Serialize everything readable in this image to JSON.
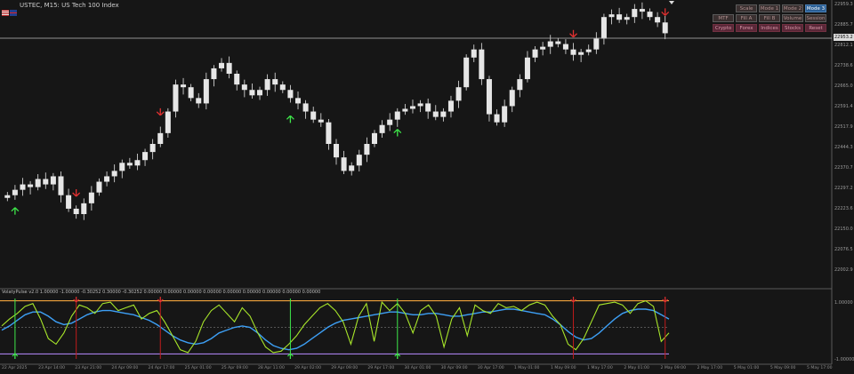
{
  "window": {
    "title": "USTEC, M15: US Tech 100 Index",
    "indicator_label": "VolatyPulse v2.0 1.00000 -1.00000 -0.30252 0.30000 -0.30252 0.00000 0.00000 0.00000 0.00000 0.00000 0.00000 0.00000 0.00000 0.00000"
  },
  "icons": {
    "flag": "us-gb-flag-icon",
    "collapse": "triangle-down-icon"
  },
  "colors": {
    "background": "#161616",
    "candle": "#e6e6e6",
    "osc_fast": "#a8e62a",
    "osc_slow": "#3d9ff5",
    "upper_band": "#f0a33c",
    "lower_band": "#a67ee8",
    "signal_line": "#c01b1b",
    "up_arrow": "#3ee84a",
    "down_arrow": "#e03030",
    "price_line": "#bdbdbd",
    "mode3_button": "#2b5f95",
    "pink_button": "#5a2738"
  },
  "buttons": {
    "row1": [
      "Scale",
      "Mode 1",
      "Mode 2",
      "Mode 3"
    ],
    "row2": [
      "MTF",
      "Fill A",
      "Fill B",
      "Volume",
      "Session"
    ],
    "row3": [
      "Crypto",
      "Forex",
      "Indices",
      "Stocks",
      "Reset"
    ]
  },
  "price_axis": {
    "labels": [
      "22959.3",
      "22885.7",
      "22812.1",
      "22738.6",
      "22665.0",
      "22591.4",
      "22517.9",
      "22444.3",
      "22370.7",
      "22297.2",
      "22223.6",
      "22150.0",
      "22076.5",
      "22002.9"
    ],
    "current": "22953.2",
    "osc_top": "1.00000",
    "osc_bottom": "-1.00000"
  },
  "time_axis": {
    "labels": [
      "22 Apr 2025",
      "23 Apr 14:00",
      "23 Apr 21:00",
      "24 Apr 09:00",
      "24 Apr 17:00",
      "25 Apr 01:00",
      "25 Apr 09:00",
      "28 Apr 11:00",
      "29 Apr 02:00",
      "29 Apr 09:00",
      "29 Apr 17:00",
      "30 Apr 01:00",
      "30 Apr 09:00",
      "30 Apr 17:00",
      "1 May 01:00",
      "1 May 09:00",
      "1 May 17:00",
      "2 May 01:00",
      "2 May 09:00",
      "2 May 17:00",
      "5 May 01:00",
      "5 May 09:00",
      "5 May 17:00"
    ]
  },
  "chart_data": {
    "type": "candlestick",
    "price_ylim": [
      21960,
      23000
    ],
    "close": [
      22290,
      22310,
      22330,
      22320,
      22350,
      22330,
      22360,
      22290,
      22240,
      22220,
      22260,
      22300,
      22340,
      22360,
      22380,
      22410,
      22400,
      22420,
      22450,
      22480,
      22520,
      22600,
      22700,
      22690,
      22650,
      22630,
      22720,
      22760,
      22780,
      22740,
      22700,
      22680,
      22660,
      22680,
      22720,
      22700,
      22680,
      22650,
      22630,
      22600,
      22570,
      22560,
      22480,
      22430,
      22380,
      22400,
      22440,
      22480,
      22520,
      22550,
      22570,
      22600,
      22610,
      22620,
      22630,
      22600,
      22580,
      22600,
      22640,
      22690,
      22800,
      22830,
      22720,
      22590,
      22560,
      22620,
      22680,
      22720,
      22800,
      22830,
      22840,
      22860,
      22850,
      22830,
      22810,
      22820,
      22830,
      22870,
      22950,
      22960,
      22940,
      22950,
      22980,
      22970,
      22950,
      22930,
      22890
    ],
    "signals": [
      {
        "type": "up",
        "index": 1
      },
      {
        "type": "down",
        "index": 9
      },
      {
        "type": "down",
        "index": 20
      },
      {
        "type": "up",
        "index": 37
      },
      {
        "type": "up",
        "index": 51
      },
      {
        "type": "down",
        "index": 74
      },
      {
        "type": "down",
        "index": 100
      }
    ],
    "oscillator": {
      "ylim": [
        -1,
        1
      ],
      "upper": 0.95,
      "lower": -0.95,
      "mid": 0,
      "fast": [
        0.05,
        0.3,
        0.5,
        0.75,
        0.85,
        0.3,
        -0.4,
        -0.6,
        -0.2,
        0.4,
        0.8,
        0.7,
        0.5,
        0.85,
        0.9,
        0.6,
        0.7,
        0.8,
        0.3,
        0.5,
        0.6,
        0.2,
        -0.3,
        -0.8,
        -0.9,
        -0.5,
        0.2,
        0.6,
        0.8,
        0.5,
        0.2,
        0.7,
        0.4,
        -0.2,
        -0.7,
        -0.9,
        -0.85,
        -0.6,
        -0.3,
        0.1,
        0.4,
        0.7,
        0.85,
        0.6,
        0.2,
        -0.6,
        0.4,
        0.85,
        -0.5,
        0.9,
        0.6,
        0.85,
        0.5,
        -0.2,
        0.6,
        0.8,
        0.4,
        -0.7,
        0.3,
        0.7,
        -0.3,
        0.8,
        0.6,
        0.5,
        0.85,
        0.7,
        0.75,
        0.6,
        0.8,
        0.9,
        0.8,
        0.4,
        0.1,
        -0.6,
        -0.8,
        -0.4,
        0.2,
        0.8,
        0.85,
        0.9,
        0.8,
        0.5,
        0.85,
        0.95,
        0.75,
        -0.5,
        -0.2
      ],
      "slow": [
        -0.1,
        0.05,
        0.25,
        0.45,
        0.55,
        0.55,
        0.4,
        0.2,
        0.1,
        0.15,
        0.3,
        0.45,
        0.55,
        0.6,
        0.6,
        0.55,
        0.5,
        0.45,
        0.35,
        0.25,
        0.1,
        -0.1,
        -0.3,
        -0.45,
        -0.55,
        -0.6,
        -0.55,
        -0.4,
        -0.2,
        -0.1,
        0.0,
        0.05,
        0.0,
        -0.2,
        -0.45,
        -0.65,
        -0.75,
        -0.8,
        -0.75,
        -0.6,
        -0.4,
        -0.2,
        0.0,
        0.15,
        0.25,
        0.3,
        0.35,
        0.4,
        0.45,
        0.5,
        0.55,
        0.55,
        0.5,
        0.45,
        0.45,
        0.5,
        0.5,
        0.45,
        0.4,
        0.4,
        0.45,
        0.5,
        0.55,
        0.55,
        0.6,
        0.65,
        0.65,
        0.6,
        0.55,
        0.5,
        0.45,
        0.3,
        0.1,
        -0.15,
        -0.35,
        -0.45,
        -0.4,
        -0.2,
        0.05,
        0.3,
        0.5,
        0.6,
        0.65,
        0.65,
        0.6,
        0.45,
        0.3
      ]
    }
  }
}
